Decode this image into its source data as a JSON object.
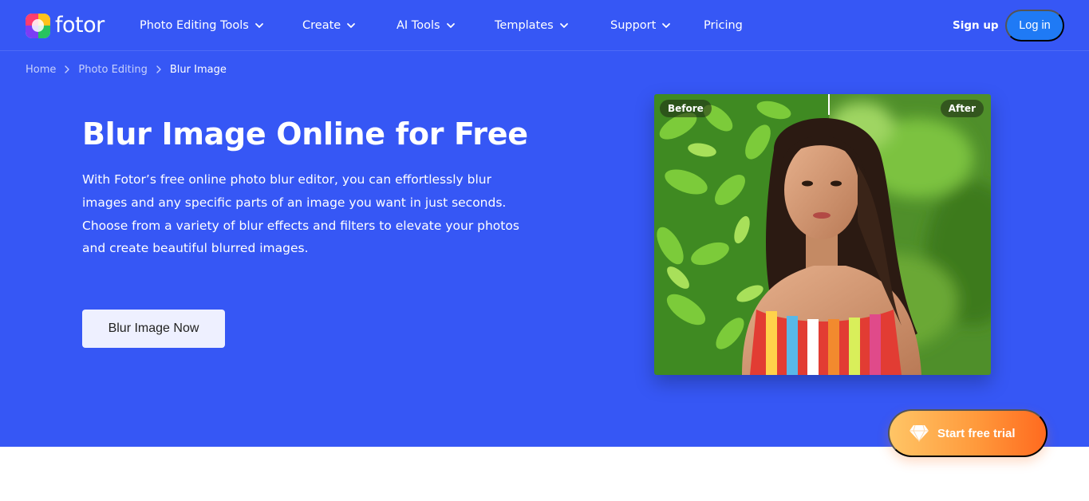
{
  "brand": {
    "name": "fotor"
  },
  "nav": {
    "items": [
      {
        "label": "Photo Editing Tools",
        "has_dropdown": true
      },
      {
        "label": "Create",
        "has_dropdown": true
      },
      {
        "label": "AI Tools",
        "has_dropdown": true
      },
      {
        "label": "Templates",
        "has_dropdown": true
      },
      {
        "label": "Support",
        "has_dropdown": true
      },
      {
        "label": "Pricing",
        "has_dropdown": false
      }
    ],
    "signup_label": "Sign up",
    "login_label": "Log in"
  },
  "breadcrumb": {
    "items": [
      "Home",
      "Photo Editing",
      "Blur Image"
    ]
  },
  "hero": {
    "title": "Blur Image Online for Free",
    "paragraph_1": "With Fotor’s free online photo blur editor, you can effortlessly blur images and any specific parts of an image you want in just seconds.",
    "paragraph_2": "Choose from a variety of blur effects and filters to elevate your photos and create beautiful blurred images.",
    "cta_label": "Blur Image Now"
  },
  "comparison": {
    "before_label": "Before",
    "after_label": "After"
  },
  "trial": {
    "label": "Start free trial",
    "icon": "diamond-icon"
  },
  "colors": {
    "hero_bg": "#3657f5",
    "login_bg": "#1f7af5",
    "cta_bg": "#eef0ff",
    "trial_gradient_start": "#ffc566",
    "trial_gradient_end": "#ff6a1f"
  }
}
